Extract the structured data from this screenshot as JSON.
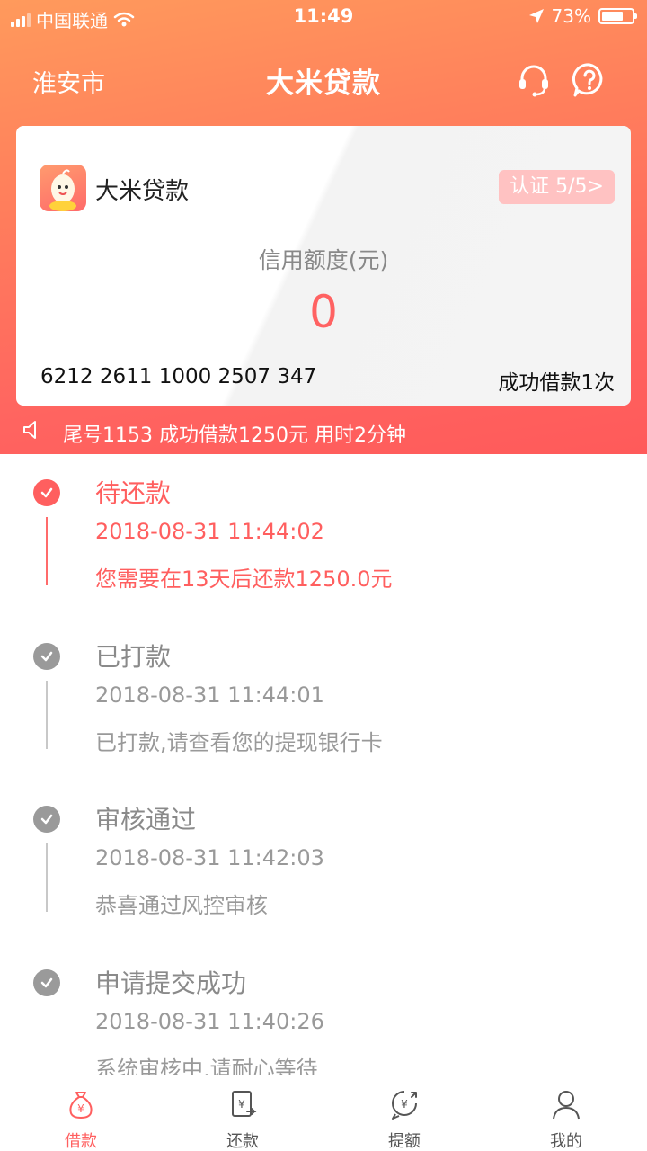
{
  "status_bar": {
    "carrier": "中国联通",
    "time": "11:49",
    "battery": "73%",
    "battery_level": 0.73
  },
  "nav": {
    "city": "淮安市",
    "title": "大米贷款",
    "icons": [
      "headset-icon",
      "help-icon"
    ]
  },
  "card": {
    "brand": "大米贷款",
    "cert_label": "认证 5/5>",
    "limit_label": "信用额度(元)",
    "limit_value": "0",
    "card_number": "6212 2611 1000 2507 347",
    "success_count": "成功借款1次"
  },
  "notice": {
    "text": "尾号1153 成功借款1250元 用时2分钟"
  },
  "timeline": [
    {
      "title": "待还款",
      "time": "2018-08-31 11:44:02",
      "message": "您需要在13天后还款1250.0元",
      "active": true
    },
    {
      "title": "已打款",
      "time": "2018-08-31 11:44:01",
      "message": "已打款,请查看您的提现银行卡",
      "active": false
    },
    {
      "title": "审核通过",
      "time": "2018-08-31 11:42:03",
      "message": "恭喜通过风控审核",
      "active": false
    },
    {
      "title": "申请提交成功",
      "time": "2018-08-31 11:40:26",
      "message": "系统审核中,请耐心等待",
      "active": false
    }
  ],
  "tabs": [
    {
      "label": "借款",
      "icon": "money-bag-icon",
      "active": true
    },
    {
      "label": "还款",
      "icon": "repay-icon",
      "active": false
    },
    {
      "label": "提额",
      "icon": "raise-limit-icon",
      "active": false
    },
    {
      "label": "我的",
      "icon": "user-icon",
      "active": false
    }
  ],
  "colors": {
    "accent": "#ff5f5f",
    "header_start": "#ff9a5c",
    "header_end": "#ff5a5a",
    "inactive": "#9a9a9a"
  }
}
